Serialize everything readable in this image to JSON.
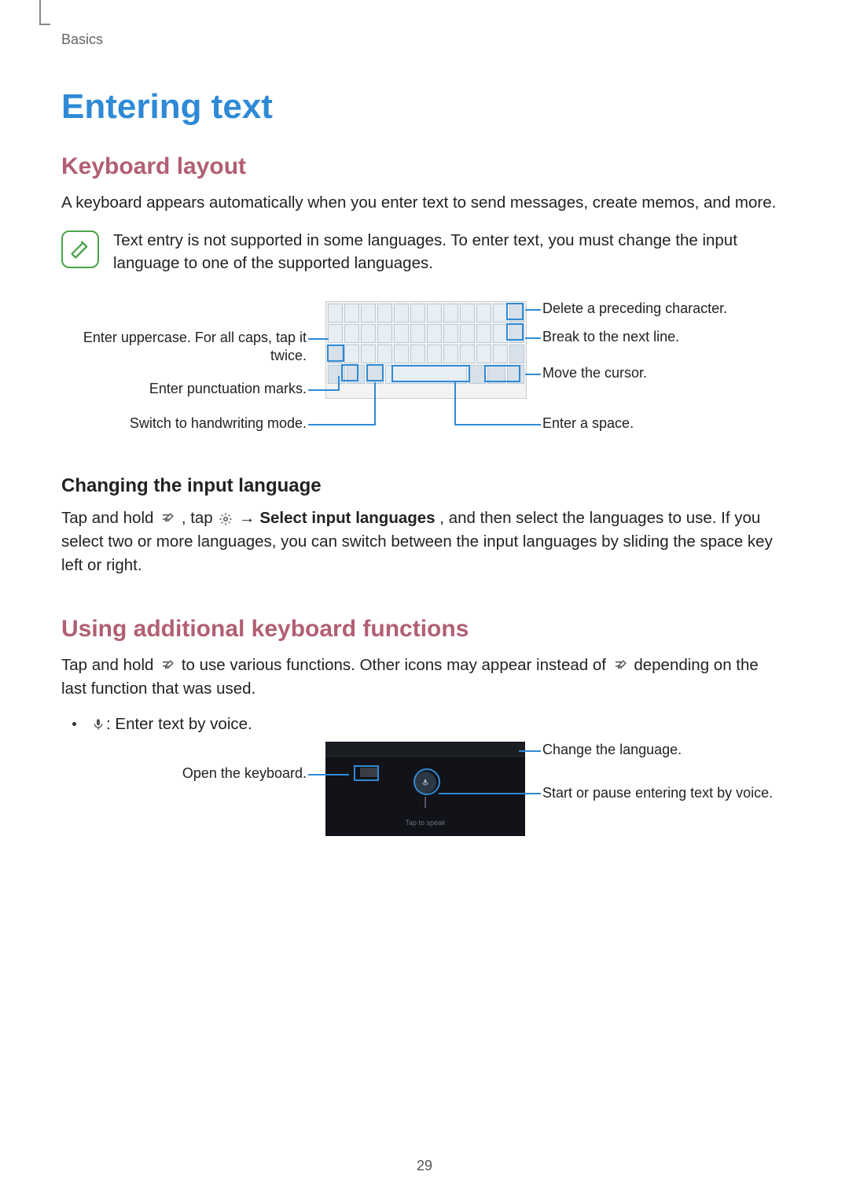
{
  "breadcrumb": "Basics",
  "h1": "Entering text",
  "section1": {
    "heading": "Keyboard layout",
    "intro": "A keyboard appears automatically when you enter text to send messages, create memos, and more.",
    "note": "Text entry is not supported in some languages. To enter text, you must change the input language to one of the supported languages."
  },
  "kb_callouts": {
    "left": {
      "uppercase": "Enter uppercase. For all caps, tap it twice.",
      "punctuation": "Enter punctuation marks.",
      "handwriting": "Switch to handwriting mode."
    },
    "right": {
      "delete": "Delete a preceding character.",
      "nextline": "Break to the next line.",
      "cursor": "Move the cursor.",
      "space": "Enter a space."
    }
  },
  "section2": {
    "heading": "Changing the input language",
    "para_pre": "Tap and hold ",
    "para_mid1": ", tap ",
    "arrow": " → ",
    "bold": "Select input languages",
    "para_post": ", and then select the languages to use. If you select two or more languages, you can switch between the input languages by sliding the space key left or right."
  },
  "section3": {
    "heading": "Using additional keyboard functions",
    "para_pre": "Tap and hold ",
    "para_mid": " to use various functions. Other icons may appear instead of ",
    "para_post": " depending on the last function that was used.",
    "bullet": " : Enter text by voice."
  },
  "voice_callouts": {
    "left": {
      "open_keyboard": "Open the keyboard."
    },
    "right": {
      "change_lang": "Change the language.",
      "start_pause": "Start or pause entering text by voice."
    },
    "caption": "Tap to speak"
  },
  "page_number": "29"
}
